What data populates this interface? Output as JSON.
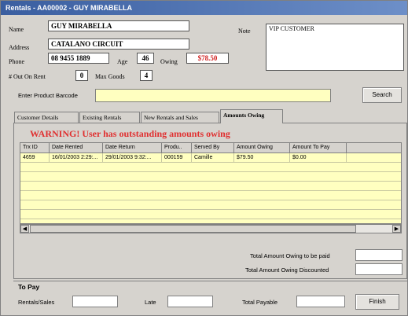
{
  "window": {
    "title": "Rentals - AA00002 - GUY MIRABELLA"
  },
  "customer": {
    "name_label": "Name",
    "name": "GUY MIRABELLA",
    "address_label": "Address",
    "address": "CATALANO CIRCUIT",
    "phone_label": "Phone",
    "phone": "08 9455 1889",
    "age_label": "Age",
    "age": "46",
    "owing_label": "Owing",
    "owing": "$78.50",
    "note_label": "Note",
    "note": "VIP CUSTOMER",
    "out_on_rent_label": "# Out On Rent",
    "out_on_rent": "0",
    "max_goods_label": "Max Goods",
    "max_goods": "4"
  },
  "barcode": {
    "label": "Enter Product Barcode",
    "value": "",
    "search_label": "Search"
  },
  "tabs": [
    {
      "label": "Customer Details"
    },
    {
      "label": "Existing Rentals"
    },
    {
      "label": "New Rentals and Sales"
    },
    {
      "label": "Amounts Owing"
    }
  ],
  "amounts_owing": {
    "warning": "WARNING! User has outstanding amounts owing",
    "columns": [
      "Trx ID",
      "Date Rented",
      "Date Return",
      "Produ..",
      "Served By",
      "Amount Owing",
      "Amount To Pay"
    ],
    "rows": [
      [
        "4659",
        "16/01/2003 2:29:...",
        "29/01/2003 9:32:...",
        "000159",
        "Camille",
        "$79.50",
        "$0.00"
      ]
    ],
    "total_owing_label": "Total Amount Owing to be paid",
    "total_owing_value": "",
    "total_discounted_label": "Total Amount Owing Discounted",
    "total_discounted_value": ""
  },
  "to_pay": {
    "heading": "To Pay",
    "rentals_label": "Rentals/Sales",
    "rentals_value": "",
    "late_label": "Late",
    "late_value": "",
    "total_label": "Total Payable",
    "total_value": "",
    "finish_label": "Finish"
  },
  "colors": {
    "title_bar": "#3a5ea0",
    "warning": "#e03030",
    "owing": "#d02020",
    "grid_bg": "#ffffc0"
  }
}
